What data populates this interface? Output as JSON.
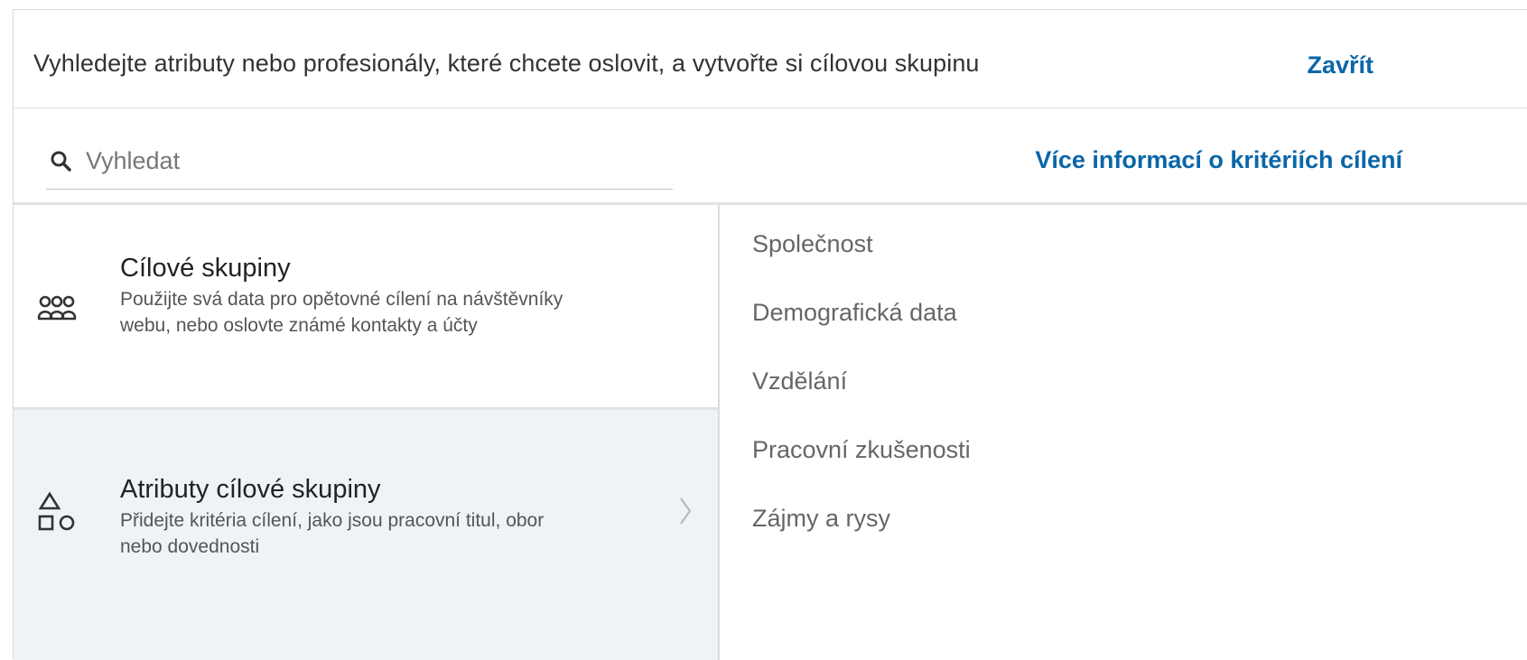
{
  "header": {
    "title": "Vyhledejte atributy nebo profesionály, které chcete oslovit, a vytvořte si cílovou skupinu",
    "close_label": "Zavřít"
  },
  "search": {
    "placeholder": "Vyhledat",
    "value": "",
    "more_info_label": "Více informací o kritériích cílení",
    "icon": "search-icon"
  },
  "options": [
    {
      "icon": "audience-group-icon",
      "title": "Cílové skupiny",
      "description": "Použijte svá data pro opětovné cílení na návštěvníky webu, nebo oslovte známé kontakty a účty"
    },
    {
      "icon": "shapes-icon",
      "title": "Atributy cílové skupiny",
      "description": "Přidejte kritéria cílení, jako jsou pracovní titul, obor nebo dovednosti"
    }
  ],
  "categories": [
    "Společnost",
    "Demografická data",
    "Vzdělání",
    "Pracovní zkušenosti",
    "Zájmy a rysy"
  ],
  "colors": {
    "link": "#0a66a8",
    "selected_bg": "#eef3f7"
  }
}
